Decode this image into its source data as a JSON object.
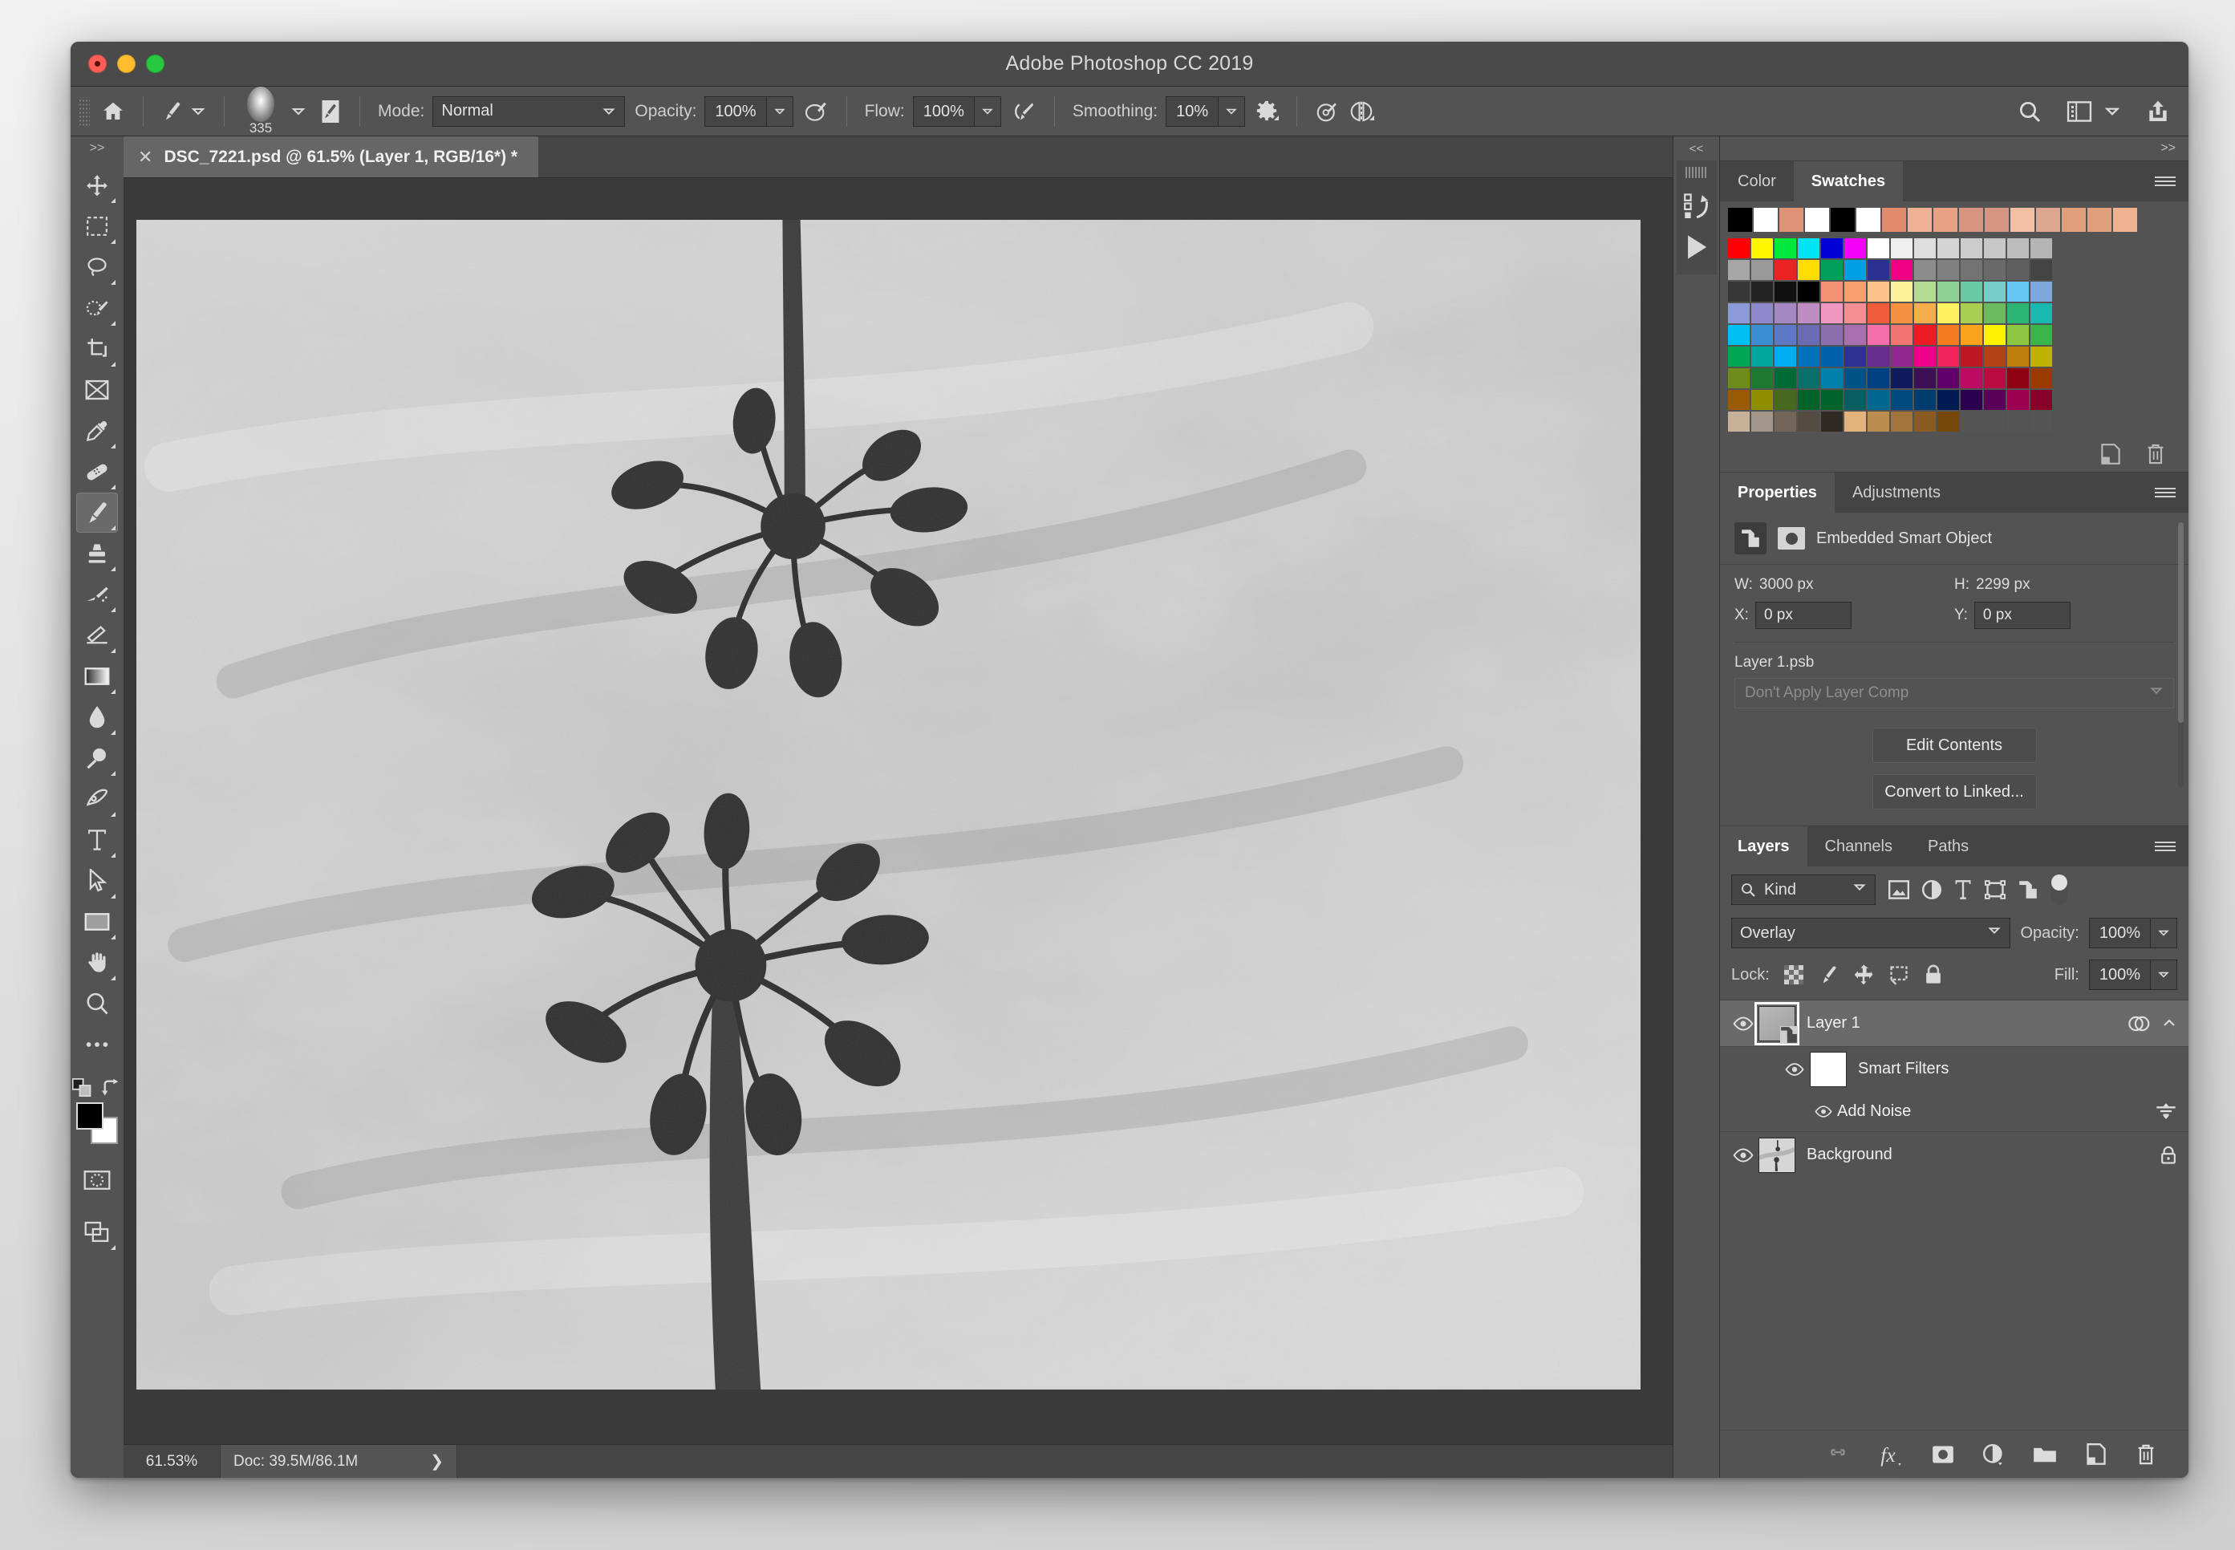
{
  "window": {
    "title": "Adobe Photoshop CC 2019"
  },
  "options_bar": {
    "home_icon": "home-icon",
    "brush_tool_icon": "brush-icon",
    "brush_size": "335",
    "brush_panel_icon": "brush-panel-icon",
    "mode_label": "Mode:",
    "mode_value": "Normal",
    "opacity_label": "Opacity:",
    "opacity_value": "100%",
    "airbrush_opacity_icon": "pressure-opacity-icon",
    "flow_label": "Flow:",
    "flow_value": "100%",
    "airbrush_icon": "airbrush-icon",
    "smoothing_label": "Smoothing:",
    "smoothing_value": "10%",
    "settings_icon": "gear-icon",
    "symmetry_icon": "symmetry-icon",
    "angle_icon": "brush-angle-icon",
    "search_icon": "search-icon",
    "workspace_icon": "workspace-panel-icon",
    "workspace_chevron_icon": "chevron-down-icon",
    "share_icon": "share-icon"
  },
  "toolbox": {
    "collapse_label": ">>",
    "tools": [
      {
        "name": "move-tool",
        "icon": "move-icon",
        "has_more": true
      },
      {
        "name": "marquee-tool",
        "icon": "rect-marquee-icon",
        "has_more": true
      },
      {
        "name": "lasso-tool",
        "icon": "lasso-icon",
        "has_more": true
      },
      {
        "name": "quick-selection-tool",
        "icon": "quick-select-icon",
        "has_more": true
      },
      {
        "name": "crop-tool",
        "icon": "crop-icon",
        "has_more": true
      },
      {
        "name": "frame-tool",
        "icon": "frame-icon",
        "has_more": false
      },
      {
        "name": "eyedropper-tool",
        "icon": "eyedropper-icon",
        "has_more": true
      },
      {
        "name": "healing-brush-tool",
        "icon": "bandage-icon",
        "has_more": true
      },
      {
        "name": "brush-tool",
        "icon": "brush-icon",
        "has_more": true,
        "active": true
      },
      {
        "name": "clone-stamp-tool",
        "icon": "stamp-icon",
        "has_more": true
      },
      {
        "name": "history-brush-tool",
        "icon": "history-brush-icon",
        "has_more": true
      },
      {
        "name": "eraser-tool",
        "icon": "eraser-icon",
        "has_more": true
      },
      {
        "name": "gradient-tool",
        "icon": "gradient-icon",
        "has_more": true
      },
      {
        "name": "blur-tool",
        "icon": "blur-drop-icon",
        "has_more": true
      },
      {
        "name": "dodge-tool",
        "icon": "dodge-icon",
        "has_more": true
      },
      {
        "name": "pen-tool",
        "icon": "pen-icon",
        "has_more": true
      },
      {
        "name": "type-tool",
        "icon": "type-t-icon",
        "has_more": true
      },
      {
        "name": "path-selection-tool",
        "icon": "arrow-pointer-icon",
        "has_more": true
      },
      {
        "name": "rectangle-tool",
        "icon": "rectangle-icon",
        "has_more": true
      },
      {
        "name": "hand-tool",
        "icon": "hand-icon",
        "has_more": true
      },
      {
        "name": "zoom-tool",
        "icon": "magnifier-icon",
        "has_more": false
      },
      {
        "name": "edit-toolbar",
        "icon": "ellipsis-icon",
        "has_more": false
      }
    ],
    "swap_colors_icon": "swap-colors-icon",
    "default_colors_icon": "default-colors-icon",
    "foreground_color": "#000000",
    "background_color": "#ffffff",
    "quick_mask_icon": "quick-mask-icon",
    "screen_mode_icon": "screen-mode-icon"
  },
  "document": {
    "tab_title": "DSC_7221.psd @ 61.5% (Layer 1, RGB/16*) *",
    "close_icon": "close-icon"
  },
  "status_bar": {
    "zoom": "61.53%",
    "doc_info": "Doc: 39.5M/86.1M",
    "expand_icon": "chevron-right-icon"
  },
  "panels": {
    "collapse_icon": "<<",
    "expand_icon": ">>",
    "rail": {
      "history_icon": "history-icon",
      "actions_icon": "play-actions-icon"
    },
    "swatches": {
      "tabs": [
        {
          "label": "Color",
          "active": false
        },
        {
          "label": "Swatches",
          "active": true
        }
      ],
      "menu_icon": "panel-menu-icon",
      "recent": [
        "#000000",
        "#ffffff",
        "#e09274",
        "#ffffff",
        "#000000",
        "#ffffff",
        "#e28a6c",
        "#f0b295",
        "#e8a183",
        "#d79580",
        "#d79583",
        "#f3c0a4",
        "#dda68e",
        "#e0a07c",
        "#e0a07c",
        "#f0b38f"
      ],
      "grid": [
        "#fe0000",
        "#fff600",
        "#00e83c",
        "#00e5f5",
        "#0000d4",
        "#f400f9",
        "#ffffff",
        "#efefef",
        "#dedede",
        "#d4d4d4",
        "#cccccc",
        "#c7c7c7",
        "#bdbdbd",
        "#b5b5b5",
        "#a6a6a6",
        "#9a9a9a",
        "#ea2222",
        "#ffdd00",
        "#00a05b",
        "#00a0e4",
        "#2c3191",
        "#ef0084",
        "#8c8c8c",
        "#808080",
        "#737373",
        "#6a6a6a",
        "#5f5f5f",
        "#444444",
        "#373737",
        "#242424",
        "#111111",
        "#000000",
        "#f39275",
        "#f7a171",
        "#fbc28c",
        "#fdf19a",
        "#b5dc93",
        "#8ed295",
        "#68c9a2",
        "#74cdc9",
        "#66c8f5",
        "#7fa8de",
        "#8b9bd9",
        "#8e88cc",
        "#a587c4",
        "#bf8cc4",
        "#f198c1",
        "#f38e93",
        "#ee5c3c",
        "#f4913e",
        "#f6ae4c",
        "#fcf15f",
        "#a8cf52",
        "#69bb5e",
        "#2bb573",
        "#17b9b0",
        "#00bff2",
        "#3b8ed2",
        "#5d78c4",
        "#6a6bb2",
        "#8e6fae",
        "#a96fae",
        "#f26fab",
        "#f07470",
        "#ed1c24",
        "#f47b20",
        "#faa31b",
        "#fff200",
        "#8dc63f",
        "#39b54a",
        "#00a651",
        "#00a79d",
        "#00aeef",
        "#0072bc",
        "#0060a9",
        "#2e3192",
        "#662d91",
        "#92278f",
        "#ec008c",
        "#f0245c",
        "#be1622",
        "#b34214",
        "#bf7f0d",
        "#bdb300",
        "#6e8b1b",
        "#1d7a30",
        "#006a34",
        "#0a6e6b",
        "#0081ab",
        "#005287",
        "#00417f",
        "#101b5e",
        "#3d1055",
        "#62006b",
        "#bd0a62",
        "#ba0c41",
        "#8f0012",
        "#9a3a00",
        "#9b5b04",
        "#8f8f00",
        "#47691f",
        "#006428",
        "#00632a",
        "#065e60",
        "#00688f",
        "#014a80",
        "#003c6e",
        "#001a52",
        "#2c0050",
        "#5b0057",
        "#9d0050",
        "#880028",
        "#c7b299",
        "#a2968a",
        "#726659",
        "#544b42",
        "#302a24",
        "#e3b37d",
        "#bd8d4f",
        "#a0743b",
        "#8a5c22",
        "#76490b",
        "#555555",
        "#555555",
        "#555555",
        "#555555"
      ],
      "new_swatch_icon": "new-swatch-icon",
      "delete_swatch_icon": "trash-icon"
    },
    "properties": {
      "tabs": [
        {
          "label": "Properties",
          "active": true
        },
        {
          "label": "Adjustments",
          "active": false
        }
      ],
      "menu_icon": "panel-menu-icon",
      "object_type": "Embedded Smart Object",
      "smart_object_icon": "smart-object-icon",
      "mask_icon": "layer-mask-icon",
      "w_label": "W:",
      "w_value": "3000 px",
      "h_label": "H:",
      "h_value": "2299 px",
      "x_label": "X:",
      "x_value": "0 px",
      "y_label": "Y:",
      "y_value": "0 px",
      "file_name": "Layer 1.psb",
      "layer_comp_placeholder": "Don't Apply Layer Comp",
      "edit_contents_label": "Edit Contents",
      "convert_to_linked_label": "Convert to Linked..."
    },
    "layers": {
      "tabs": [
        {
          "label": "Layers",
          "active": true
        },
        {
          "label": "Channels",
          "active": false
        },
        {
          "label": "Paths",
          "active": false
        }
      ],
      "menu_icon": "panel-menu-icon",
      "filter_label": "Kind",
      "filter_search_icon": "search-icon",
      "filter_icons": [
        "pixel-layer-filter-icon",
        "adjustment-layer-filter-icon",
        "type-layer-filter-icon",
        "shape-layer-filter-icon",
        "smart-object-filter-icon"
      ],
      "filter_toggle_icon": "filter-toggle-switch",
      "blend_mode": "Overlay",
      "opacity_label": "Opacity:",
      "opacity_value": "100%",
      "lock_label": "Lock:",
      "lock_icons": [
        "lock-transparency-icon",
        "lock-image-icon",
        "lock-position-icon",
        "lock-artboard-icon",
        "lock-all-icon"
      ],
      "fill_label": "Fill:",
      "fill_value": "100%",
      "rows": [
        {
          "name": "Layer 1",
          "visible": true,
          "selected": true,
          "type": "smart-object",
          "right_icon": "smart-filter-badge-icon",
          "collapse_icon": "chevron-up-icon"
        },
        {
          "name": "Smart Filters",
          "visible": true,
          "type": "smart-filters",
          "indent": 1
        },
        {
          "name": "Add Noise",
          "visible": true,
          "type": "filter",
          "indent": 2,
          "right_icon": "filter-blending-options-icon"
        },
        {
          "name": "Background",
          "visible": true,
          "type": "background",
          "right_icon": "lock-icon"
        }
      ],
      "footer_icons": [
        "link-layers-icon",
        "layer-styles-fx-icon",
        "add-mask-icon",
        "adjustment-layer-icon",
        "new-group-icon",
        "new-layer-icon",
        "delete-layer-icon"
      ]
    }
  }
}
